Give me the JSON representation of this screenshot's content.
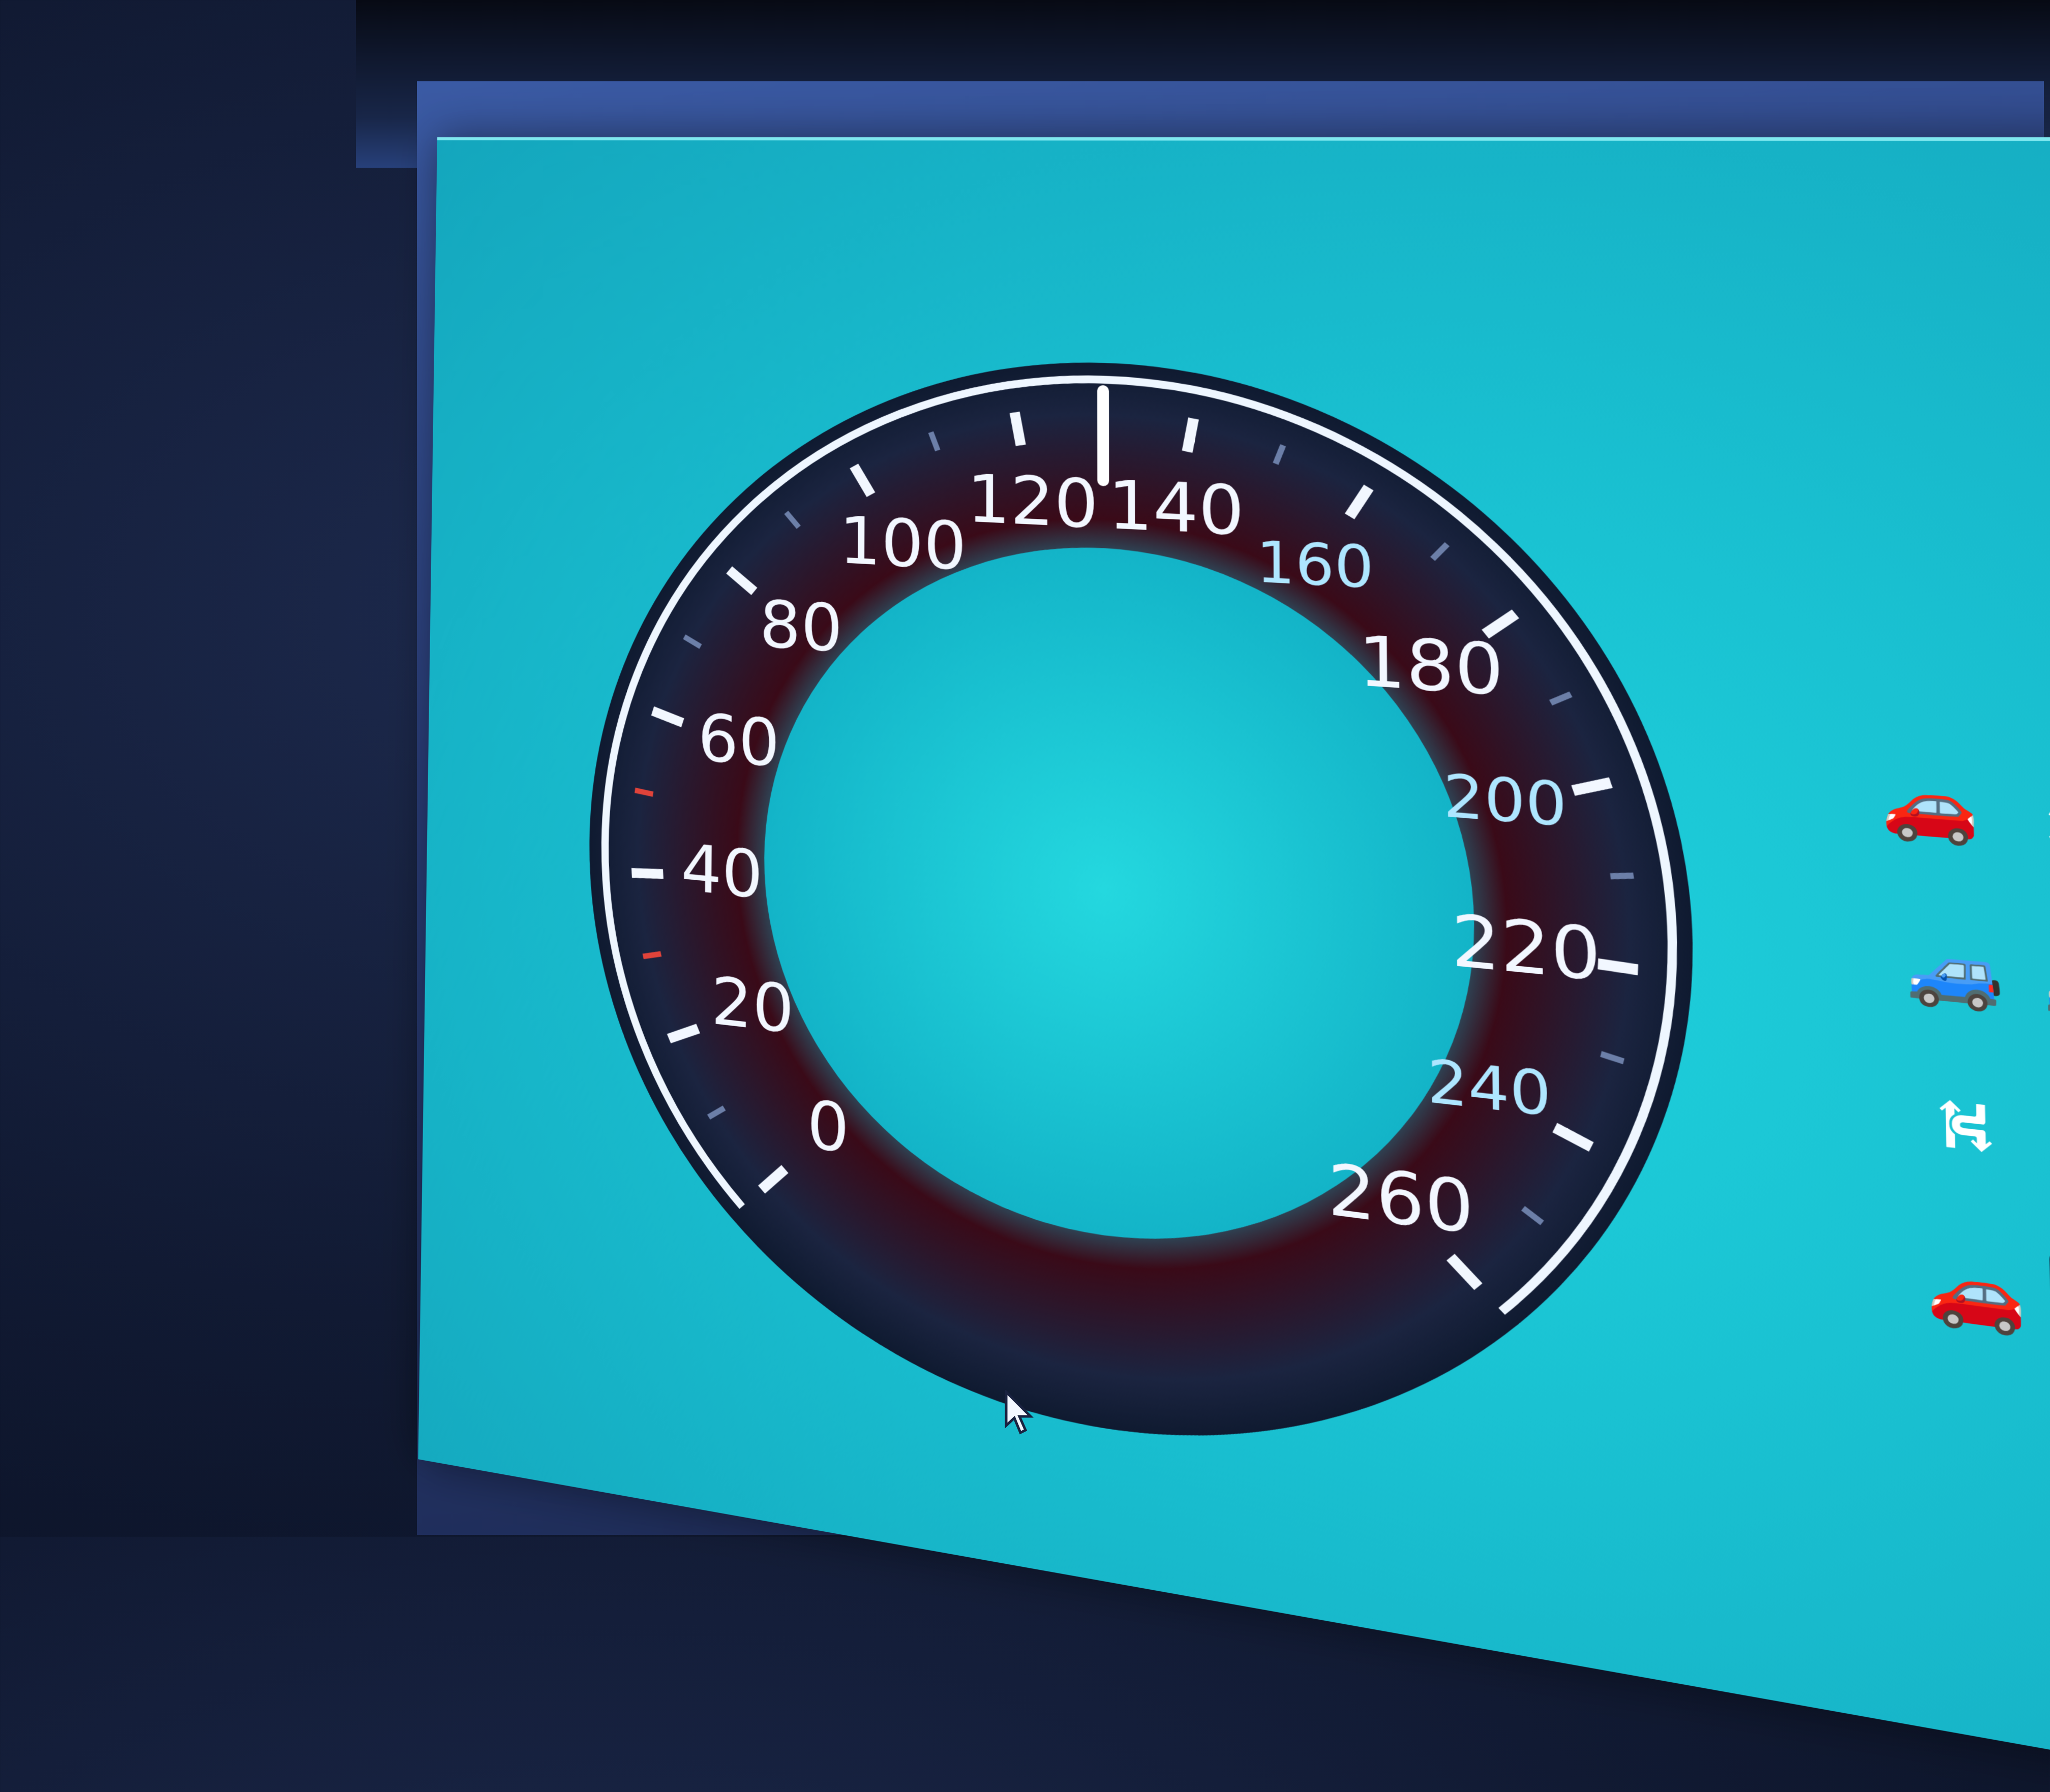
{
  "speedometer": {
    "major_labels": [
      "0",
      "20",
      "40",
      "60",
      "80",
      "100",
      "120",
      "140",
      "180",
      "220",
      "260"
    ],
    "minor_labels": [
      "160",
      "200",
      "240"
    ],
    "needle_value": 130,
    "max_value": 260
  },
  "toolbar": {
    "icons": [
      "cube-icon",
      "rectangle-icon",
      "pencil-icon",
      "dot-icon",
      "settings-icon"
    ]
  },
  "status_panel": {
    "icons": [
      {
        "name": "vehicle-light-icon",
        "glyph": "🚗",
        "color": "#e6c53a"
      },
      {
        "name": "snowflake-icon",
        "glyph": "❄",
        "color": "#ffffff"
      },
      {
        "name": "traffic-jam-icon",
        "glyph": "🚙",
        "color": "#dfe8ff"
      },
      {
        "name": "traffic-jam-alt-icon",
        "glyph": "🚙",
        "color": "#dfe8ff"
      },
      {
        "name": "road-icon",
        "glyph": "⛕",
        "color": "#ffffff"
      },
      {
        "name": "roadworks-icon",
        "glyph": "⚠",
        "color": "#e23a2a"
      },
      {
        "name": "accident-icon",
        "glyph": "🚗",
        "color": "#3ac24a"
      },
      {
        "name": "road-selected-icon",
        "glyph": "⛕",
        "color": "#ffffff"
      }
    ]
  },
  "colors": {
    "screen_teal": "#19bfd0",
    "dial_red": "#3a0a18",
    "accent_red": "#e0433a"
  }
}
